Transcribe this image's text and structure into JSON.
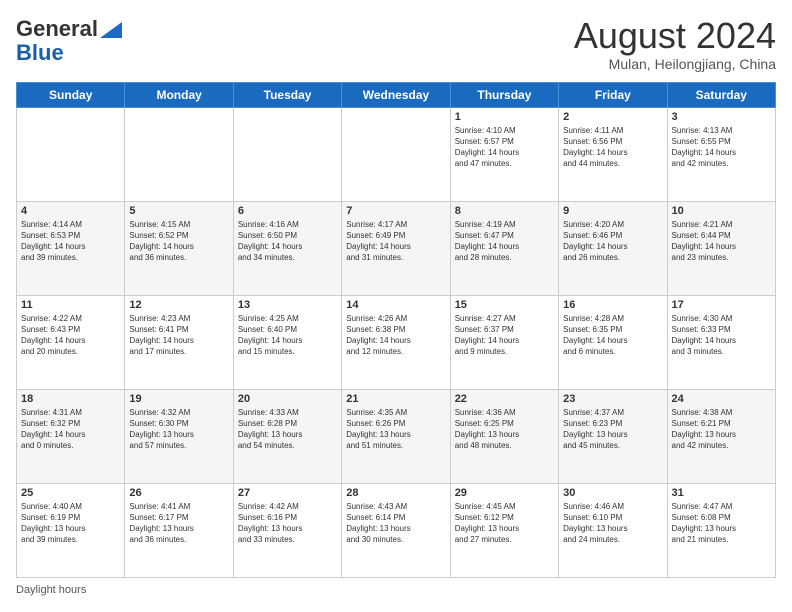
{
  "header": {
    "logo_line1": "General",
    "logo_line2": "Blue",
    "month_year": "August 2024",
    "location": "Mulan, Heilongjiang, China"
  },
  "days_of_week": [
    "Sunday",
    "Monday",
    "Tuesday",
    "Wednesday",
    "Thursday",
    "Friday",
    "Saturday"
  ],
  "footer": {
    "daylight_label": "Daylight hours"
  },
  "weeks": [
    [
      {
        "day": "",
        "info": ""
      },
      {
        "day": "",
        "info": ""
      },
      {
        "day": "",
        "info": ""
      },
      {
        "day": "",
        "info": ""
      },
      {
        "day": "1",
        "info": "Sunrise: 4:10 AM\nSunset: 6:57 PM\nDaylight: 14 hours\nand 47 minutes."
      },
      {
        "day": "2",
        "info": "Sunrise: 4:11 AM\nSunset: 6:56 PM\nDaylight: 14 hours\nand 44 minutes."
      },
      {
        "day": "3",
        "info": "Sunrise: 4:13 AM\nSunset: 6:55 PM\nDaylight: 14 hours\nand 42 minutes."
      }
    ],
    [
      {
        "day": "4",
        "info": "Sunrise: 4:14 AM\nSunset: 6:53 PM\nDaylight: 14 hours\nand 39 minutes."
      },
      {
        "day": "5",
        "info": "Sunrise: 4:15 AM\nSunset: 6:52 PM\nDaylight: 14 hours\nand 36 minutes."
      },
      {
        "day": "6",
        "info": "Sunrise: 4:16 AM\nSunset: 6:50 PM\nDaylight: 14 hours\nand 34 minutes."
      },
      {
        "day": "7",
        "info": "Sunrise: 4:17 AM\nSunset: 6:49 PM\nDaylight: 14 hours\nand 31 minutes."
      },
      {
        "day": "8",
        "info": "Sunrise: 4:19 AM\nSunset: 6:47 PM\nDaylight: 14 hours\nand 28 minutes."
      },
      {
        "day": "9",
        "info": "Sunrise: 4:20 AM\nSunset: 6:46 PM\nDaylight: 14 hours\nand 26 minutes."
      },
      {
        "day": "10",
        "info": "Sunrise: 4:21 AM\nSunset: 6:44 PM\nDaylight: 14 hours\nand 23 minutes."
      }
    ],
    [
      {
        "day": "11",
        "info": "Sunrise: 4:22 AM\nSunset: 6:43 PM\nDaylight: 14 hours\nand 20 minutes."
      },
      {
        "day": "12",
        "info": "Sunrise: 4:23 AM\nSunset: 6:41 PM\nDaylight: 14 hours\nand 17 minutes."
      },
      {
        "day": "13",
        "info": "Sunrise: 4:25 AM\nSunset: 6:40 PM\nDaylight: 14 hours\nand 15 minutes."
      },
      {
        "day": "14",
        "info": "Sunrise: 4:26 AM\nSunset: 6:38 PM\nDaylight: 14 hours\nand 12 minutes."
      },
      {
        "day": "15",
        "info": "Sunrise: 4:27 AM\nSunset: 6:37 PM\nDaylight: 14 hours\nand 9 minutes."
      },
      {
        "day": "16",
        "info": "Sunrise: 4:28 AM\nSunset: 6:35 PM\nDaylight: 14 hours\nand 6 minutes."
      },
      {
        "day": "17",
        "info": "Sunrise: 4:30 AM\nSunset: 6:33 PM\nDaylight: 14 hours\nand 3 minutes."
      }
    ],
    [
      {
        "day": "18",
        "info": "Sunrise: 4:31 AM\nSunset: 6:32 PM\nDaylight: 14 hours\nand 0 minutes."
      },
      {
        "day": "19",
        "info": "Sunrise: 4:32 AM\nSunset: 6:30 PM\nDaylight: 13 hours\nand 57 minutes."
      },
      {
        "day": "20",
        "info": "Sunrise: 4:33 AM\nSunset: 6:28 PM\nDaylight: 13 hours\nand 54 minutes."
      },
      {
        "day": "21",
        "info": "Sunrise: 4:35 AM\nSunset: 6:26 PM\nDaylight: 13 hours\nand 51 minutes."
      },
      {
        "day": "22",
        "info": "Sunrise: 4:36 AM\nSunset: 6:25 PM\nDaylight: 13 hours\nand 48 minutes."
      },
      {
        "day": "23",
        "info": "Sunrise: 4:37 AM\nSunset: 6:23 PM\nDaylight: 13 hours\nand 45 minutes."
      },
      {
        "day": "24",
        "info": "Sunrise: 4:38 AM\nSunset: 6:21 PM\nDaylight: 13 hours\nand 42 minutes."
      }
    ],
    [
      {
        "day": "25",
        "info": "Sunrise: 4:40 AM\nSunset: 6:19 PM\nDaylight: 13 hours\nand 39 minutes."
      },
      {
        "day": "26",
        "info": "Sunrise: 4:41 AM\nSunset: 6:17 PM\nDaylight: 13 hours\nand 36 minutes."
      },
      {
        "day": "27",
        "info": "Sunrise: 4:42 AM\nSunset: 6:16 PM\nDaylight: 13 hours\nand 33 minutes."
      },
      {
        "day": "28",
        "info": "Sunrise: 4:43 AM\nSunset: 6:14 PM\nDaylight: 13 hours\nand 30 minutes."
      },
      {
        "day": "29",
        "info": "Sunrise: 4:45 AM\nSunset: 6:12 PM\nDaylight: 13 hours\nand 27 minutes."
      },
      {
        "day": "30",
        "info": "Sunrise: 4:46 AM\nSunset: 6:10 PM\nDaylight: 13 hours\nand 24 minutes."
      },
      {
        "day": "31",
        "info": "Sunrise: 4:47 AM\nSunset: 6:08 PM\nDaylight: 13 hours\nand 21 minutes."
      }
    ]
  ]
}
